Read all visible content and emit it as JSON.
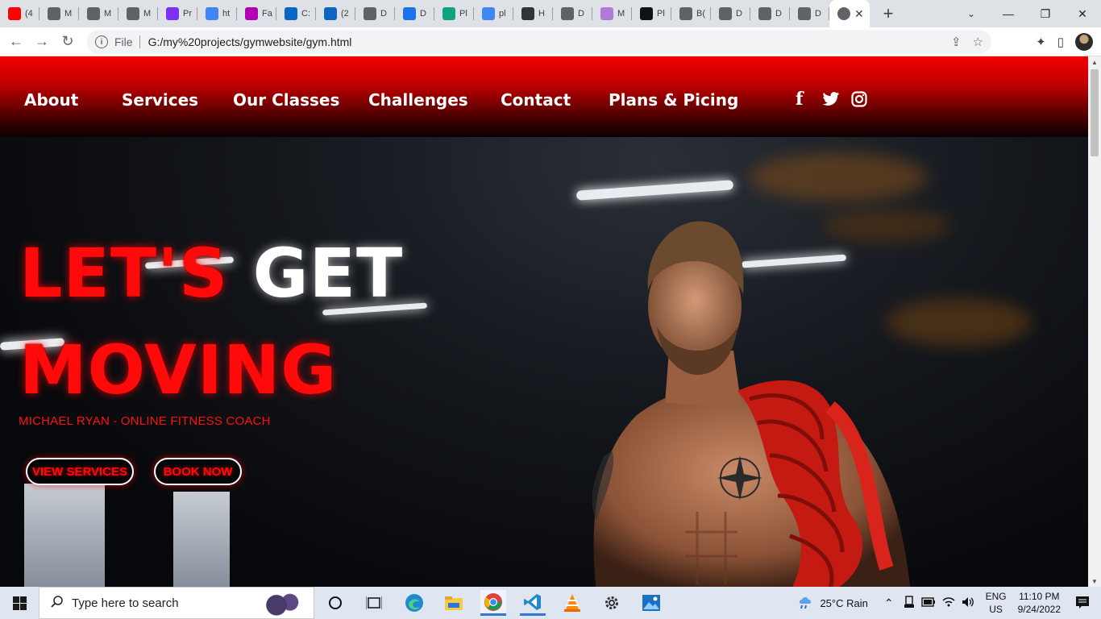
{
  "browser": {
    "tabs": [
      {
        "label": "(4",
        "color": "#ff0000"
      },
      {
        "label": "M",
        "color": "#5f6368"
      },
      {
        "label": "M",
        "color": "#5f6368"
      },
      {
        "label": "M",
        "color": "#5f6368"
      },
      {
        "label": "Pr",
        "color": "#7b2ff7"
      },
      {
        "label": "ht",
        "color": "#4285f4"
      },
      {
        "label": "Fa",
        "color": "#b300b3"
      },
      {
        "label": "C:",
        "color": "#0a66c2"
      },
      {
        "label": "(2",
        "color": "#0a66c2"
      },
      {
        "label": "D",
        "color": "#5f6368"
      },
      {
        "label": "D",
        "color": "#1a73e8"
      },
      {
        "label": "Pl",
        "color": "#10a37f"
      },
      {
        "label": "pl",
        "color": "#4285f4"
      },
      {
        "label": "H",
        "color": "#333333"
      },
      {
        "label": "D",
        "color": "#5f6368"
      },
      {
        "label": "M",
        "color": "#b07ad6"
      },
      {
        "label": "Pl",
        "color": "#111111"
      },
      {
        "label": "B(",
        "color": "#5f6368"
      },
      {
        "label": "D",
        "color": "#5f6368"
      },
      {
        "label": "D",
        "color": "#5f6368"
      },
      {
        "label": "D",
        "color": "#5f6368"
      }
    ],
    "new_tab": "+",
    "tab_close": "✕",
    "tab_search": "⌄",
    "win_min": "—",
    "win_restore": "❐",
    "win_close": "✕",
    "back": "←",
    "forward": "→",
    "reload": "↻",
    "info_icon": "i",
    "scheme": "File",
    "url": "G:/my%20projects/gymwebsite/gym.html",
    "share": "⇪",
    "bookmark": "☆",
    "extensions": "✦",
    "sidepanel": "▯"
  },
  "nav": {
    "links": [
      "About",
      "Services",
      "Our Classes",
      "Challenges",
      "Contact",
      "Plans & Picing"
    ],
    "social": {
      "facebook": "f",
      "twitter": "🐦",
      "instagram": "◎"
    }
  },
  "hero": {
    "line1_red": "LET'S ",
    "line1_white": "GET",
    "line2": "MOVING",
    "subtitle": "MICHAEL RYAN - ONLINE FITNESS COACH",
    "btn_services": "VIEW SERVICES",
    "btn_book": "BOOK NOW"
  },
  "taskbar": {
    "search_placeholder": "Type here to search",
    "weather": "25°C  Rain",
    "lang1": "ENG",
    "lang2": "US",
    "time": "11:10 PM",
    "date": "9/24/2022"
  },
  "scroll_up": "▲",
  "scroll_down": "▼"
}
